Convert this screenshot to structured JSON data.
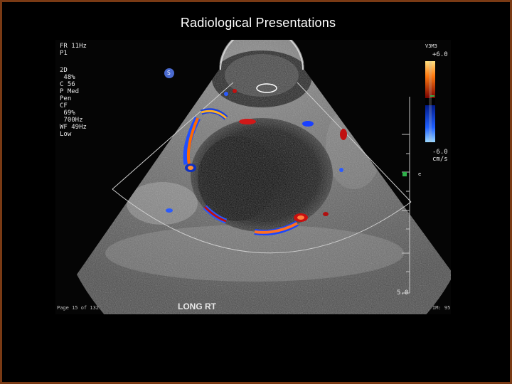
{
  "slide": {
    "title": "Radiological Presentations"
  },
  "ultrasound": {
    "header": {
      "frame_rate": "FR 11Hz",
      "preset": "P1"
    },
    "params_2d": [
      "2D",
      " 48%",
      "C 56",
      "P Med",
      "Pen"
    ],
    "params_cf": [
      "CF",
      " 69%",
      " 700Hz",
      "WF 49Hz",
      "Low"
    ],
    "marker_left": "S",
    "scale_top": "+6.0",
    "scale_bottom": "-6.0",
    "scale_unit": "cm/s",
    "scale_header": "V3M3",
    "depth_label": "5.0",
    "orientation_mark": "e",
    "view_label": "LONG RT",
    "page_info": "Page 15 of 132",
    "image_mode": "IM: 95"
  }
}
